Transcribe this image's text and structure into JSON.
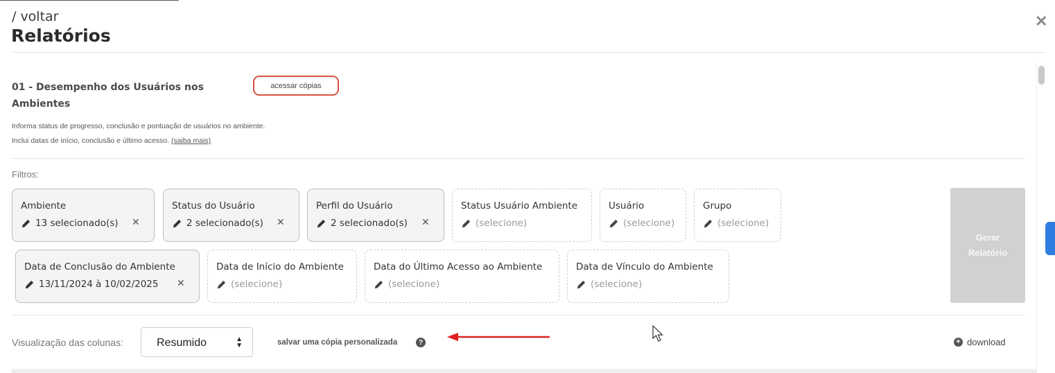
{
  "header": {
    "back_label": "/ voltar",
    "title": "Relatórios",
    "close_icon": "close-icon"
  },
  "report": {
    "title_line1": "01 - Desempenho dos Usuários nos",
    "title_line2": "Ambientes",
    "copies_button": "acessar cópias",
    "desc_line1": "Informa status de progresso, conclusão e pontuação de usuários no ambiente.",
    "desc_line2": "Inclui datas de início, conclusão e último acesso.",
    "more_link": "(saiba mais)"
  },
  "filters": {
    "label": "Filtros:",
    "row1": [
      {
        "label": "Ambiente",
        "value": "13 selecionado(s)",
        "active": true
      },
      {
        "label": "Status do Usuário",
        "value": "2 selecionado(s)",
        "active": true
      },
      {
        "label": "Perfil do Usuário",
        "value": "2 selecionado(s)",
        "active": true
      },
      {
        "label": "Status Usuário Ambiente",
        "value": "(selecione)",
        "active": false
      },
      {
        "label": "Usuário",
        "value": "(selecione)",
        "active": false
      },
      {
        "label": "Grupo",
        "value": "(selecione)",
        "active": false
      }
    ],
    "row2": [
      {
        "label": "Data de Conclusão do Ambiente",
        "value": "13/11/2024 à 10/02/2025",
        "active": true
      },
      {
        "label": "Data de Início do Ambiente",
        "value": "(selecione)",
        "active": false
      },
      {
        "label": "Data do Último Acesso ao Ambiente",
        "value": "(selecione)",
        "active": false
      },
      {
        "label": "Data de Vínculo do Ambiente",
        "value": "(selecione)",
        "active": false
      }
    ],
    "remove_symbol": "✕"
  },
  "generate_button": {
    "line1": "Gerar",
    "line2": "Relatório"
  },
  "columns": {
    "label": "Visualização das colunas:",
    "selected": "Resumido",
    "save_copy": "salvar uma cópia personalizada",
    "help_symbol": "?",
    "download": "download",
    "download_symbol": "+"
  },
  "colors": {
    "highlight_border": "#d9533f",
    "arrow": "#e02020",
    "side_tab": "#2f7de1",
    "button_disabled": "#d1d1d1"
  }
}
